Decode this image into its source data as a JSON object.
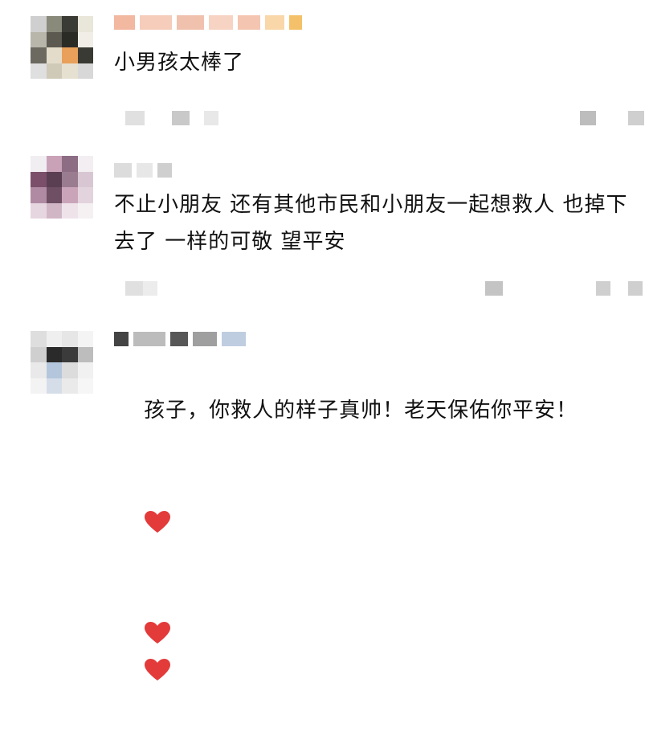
{
  "comments": [
    {
      "text": "小男孩太棒了"
    },
    {
      "text": "不止小朋友 还有其他市民和小朋友一起想救人 也掉下去了 一样的可敬 望平安"
    },
    {
      "text": "孩子，你救人的样子真帅！老天保佑你平安！"
    }
  ],
  "icons": {
    "heart": "heart-emoji-icon"
  },
  "colors": {
    "text": "#111111",
    "heart": "#e33a3a",
    "blur": "#d4d4d4"
  }
}
